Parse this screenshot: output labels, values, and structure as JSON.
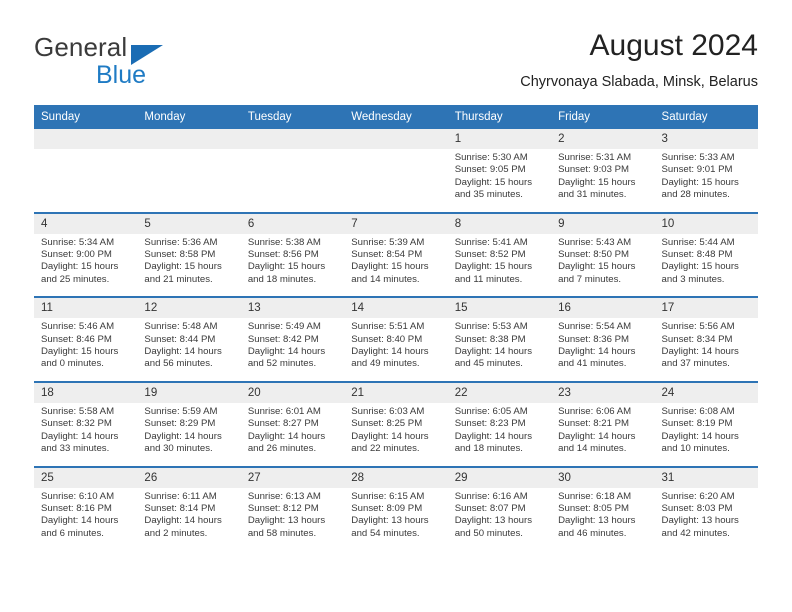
{
  "brand": {
    "name_part1": "General",
    "name_part2": "Blue",
    "icon": "triangle-logo-icon",
    "color_dark": "#3b3b3b",
    "color_blue": "#1f7bc4"
  },
  "header": {
    "title": "August 2024",
    "subtitle": "Chyrvonaya Slabada, Minsk, Belarus"
  },
  "theme": {
    "header_blue": "#2e74b5",
    "daynum_band": "#eeeeee",
    "text": "#3a3a3a"
  },
  "calendar": {
    "weekday_headers": [
      "Sunday",
      "Monday",
      "Tuesday",
      "Wednesday",
      "Thursday",
      "Friday",
      "Saturday"
    ],
    "weeks": [
      [
        {
          "day": "",
          "sunrise": "",
          "sunset": "",
          "daylight_line1": "",
          "daylight_line2": ""
        },
        {
          "day": "",
          "sunrise": "",
          "sunset": "",
          "daylight_line1": "",
          "daylight_line2": ""
        },
        {
          "day": "",
          "sunrise": "",
          "sunset": "",
          "daylight_line1": "",
          "daylight_line2": ""
        },
        {
          "day": "",
          "sunrise": "",
          "sunset": "",
          "daylight_line1": "",
          "daylight_line2": ""
        },
        {
          "day": "1",
          "sunrise": "Sunrise: 5:30 AM",
          "sunset": "Sunset: 9:05 PM",
          "daylight_line1": "Daylight: 15 hours",
          "daylight_line2": "and 35 minutes."
        },
        {
          "day": "2",
          "sunrise": "Sunrise: 5:31 AM",
          "sunset": "Sunset: 9:03 PM",
          "daylight_line1": "Daylight: 15 hours",
          "daylight_line2": "and 31 minutes."
        },
        {
          "day": "3",
          "sunrise": "Sunrise: 5:33 AM",
          "sunset": "Sunset: 9:01 PM",
          "daylight_line1": "Daylight: 15 hours",
          "daylight_line2": "and 28 minutes."
        }
      ],
      [
        {
          "day": "4",
          "sunrise": "Sunrise: 5:34 AM",
          "sunset": "Sunset: 9:00 PM",
          "daylight_line1": "Daylight: 15 hours",
          "daylight_line2": "and 25 minutes."
        },
        {
          "day": "5",
          "sunrise": "Sunrise: 5:36 AM",
          "sunset": "Sunset: 8:58 PM",
          "daylight_line1": "Daylight: 15 hours",
          "daylight_line2": "and 21 minutes."
        },
        {
          "day": "6",
          "sunrise": "Sunrise: 5:38 AM",
          "sunset": "Sunset: 8:56 PM",
          "daylight_line1": "Daylight: 15 hours",
          "daylight_line2": "and 18 minutes."
        },
        {
          "day": "7",
          "sunrise": "Sunrise: 5:39 AM",
          "sunset": "Sunset: 8:54 PM",
          "daylight_line1": "Daylight: 15 hours",
          "daylight_line2": "and 14 minutes."
        },
        {
          "day": "8",
          "sunrise": "Sunrise: 5:41 AM",
          "sunset": "Sunset: 8:52 PM",
          "daylight_line1": "Daylight: 15 hours",
          "daylight_line2": "and 11 minutes."
        },
        {
          "day": "9",
          "sunrise": "Sunrise: 5:43 AM",
          "sunset": "Sunset: 8:50 PM",
          "daylight_line1": "Daylight: 15 hours",
          "daylight_line2": "and 7 minutes."
        },
        {
          "day": "10",
          "sunrise": "Sunrise: 5:44 AM",
          "sunset": "Sunset: 8:48 PM",
          "daylight_line1": "Daylight: 15 hours",
          "daylight_line2": "and 3 minutes."
        }
      ],
      [
        {
          "day": "11",
          "sunrise": "Sunrise: 5:46 AM",
          "sunset": "Sunset: 8:46 PM",
          "daylight_line1": "Daylight: 15 hours",
          "daylight_line2": "and 0 minutes."
        },
        {
          "day": "12",
          "sunrise": "Sunrise: 5:48 AM",
          "sunset": "Sunset: 8:44 PM",
          "daylight_line1": "Daylight: 14 hours",
          "daylight_line2": "and 56 minutes."
        },
        {
          "day": "13",
          "sunrise": "Sunrise: 5:49 AM",
          "sunset": "Sunset: 8:42 PM",
          "daylight_line1": "Daylight: 14 hours",
          "daylight_line2": "and 52 minutes."
        },
        {
          "day": "14",
          "sunrise": "Sunrise: 5:51 AM",
          "sunset": "Sunset: 8:40 PM",
          "daylight_line1": "Daylight: 14 hours",
          "daylight_line2": "and 49 minutes."
        },
        {
          "day": "15",
          "sunrise": "Sunrise: 5:53 AM",
          "sunset": "Sunset: 8:38 PM",
          "daylight_line1": "Daylight: 14 hours",
          "daylight_line2": "and 45 minutes."
        },
        {
          "day": "16",
          "sunrise": "Sunrise: 5:54 AM",
          "sunset": "Sunset: 8:36 PM",
          "daylight_line1": "Daylight: 14 hours",
          "daylight_line2": "and 41 minutes."
        },
        {
          "day": "17",
          "sunrise": "Sunrise: 5:56 AM",
          "sunset": "Sunset: 8:34 PM",
          "daylight_line1": "Daylight: 14 hours",
          "daylight_line2": "and 37 minutes."
        }
      ],
      [
        {
          "day": "18",
          "sunrise": "Sunrise: 5:58 AM",
          "sunset": "Sunset: 8:32 PM",
          "daylight_line1": "Daylight: 14 hours",
          "daylight_line2": "and 33 minutes."
        },
        {
          "day": "19",
          "sunrise": "Sunrise: 5:59 AM",
          "sunset": "Sunset: 8:29 PM",
          "daylight_line1": "Daylight: 14 hours",
          "daylight_line2": "and 30 minutes."
        },
        {
          "day": "20",
          "sunrise": "Sunrise: 6:01 AM",
          "sunset": "Sunset: 8:27 PM",
          "daylight_line1": "Daylight: 14 hours",
          "daylight_line2": "and 26 minutes."
        },
        {
          "day": "21",
          "sunrise": "Sunrise: 6:03 AM",
          "sunset": "Sunset: 8:25 PM",
          "daylight_line1": "Daylight: 14 hours",
          "daylight_line2": "and 22 minutes."
        },
        {
          "day": "22",
          "sunrise": "Sunrise: 6:05 AM",
          "sunset": "Sunset: 8:23 PM",
          "daylight_line1": "Daylight: 14 hours",
          "daylight_line2": "and 18 minutes."
        },
        {
          "day": "23",
          "sunrise": "Sunrise: 6:06 AM",
          "sunset": "Sunset: 8:21 PM",
          "daylight_line1": "Daylight: 14 hours",
          "daylight_line2": "and 14 minutes."
        },
        {
          "day": "24",
          "sunrise": "Sunrise: 6:08 AM",
          "sunset": "Sunset: 8:19 PM",
          "daylight_line1": "Daylight: 14 hours",
          "daylight_line2": "and 10 minutes."
        }
      ],
      [
        {
          "day": "25",
          "sunrise": "Sunrise: 6:10 AM",
          "sunset": "Sunset: 8:16 PM",
          "daylight_line1": "Daylight: 14 hours",
          "daylight_line2": "and 6 minutes."
        },
        {
          "day": "26",
          "sunrise": "Sunrise: 6:11 AM",
          "sunset": "Sunset: 8:14 PM",
          "daylight_line1": "Daylight: 14 hours",
          "daylight_line2": "and 2 minutes."
        },
        {
          "day": "27",
          "sunrise": "Sunrise: 6:13 AM",
          "sunset": "Sunset: 8:12 PM",
          "daylight_line1": "Daylight: 13 hours",
          "daylight_line2": "and 58 minutes."
        },
        {
          "day": "28",
          "sunrise": "Sunrise: 6:15 AM",
          "sunset": "Sunset: 8:09 PM",
          "daylight_line1": "Daylight: 13 hours",
          "daylight_line2": "and 54 minutes."
        },
        {
          "day": "29",
          "sunrise": "Sunrise: 6:16 AM",
          "sunset": "Sunset: 8:07 PM",
          "daylight_line1": "Daylight: 13 hours",
          "daylight_line2": "and 50 minutes."
        },
        {
          "day": "30",
          "sunrise": "Sunrise: 6:18 AM",
          "sunset": "Sunset: 8:05 PM",
          "daylight_line1": "Daylight: 13 hours",
          "daylight_line2": "and 46 minutes."
        },
        {
          "day": "31",
          "sunrise": "Sunrise: 6:20 AM",
          "sunset": "Sunset: 8:03 PM",
          "daylight_line1": "Daylight: 13 hours",
          "daylight_line2": "and 42 minutes."
        }
      ]
    ]
  }
}
